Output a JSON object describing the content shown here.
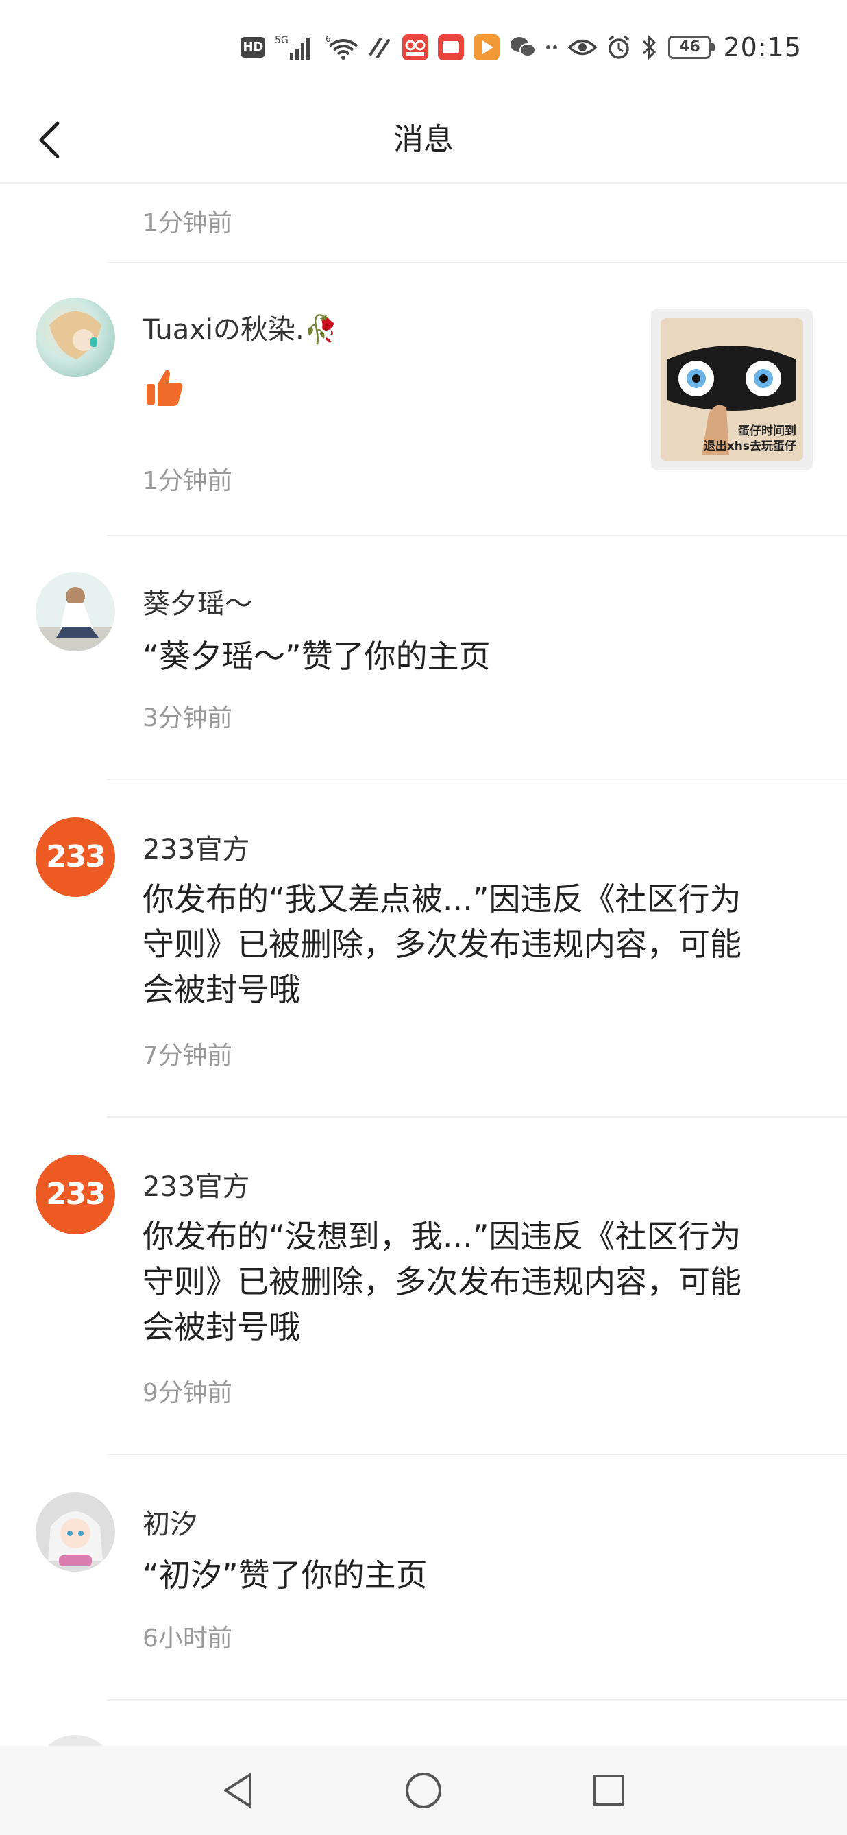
{
  "status_bar": {
    "network": "5G",
    "signal2": "6",
    "battery": "46",
    "time": "20:15",
    "hd": "HD"
  },
  "header": {
    "title": "消息"
  },
  "messages": [
    {
      "time": "1分钟前"
    },
    {
      "name": "Tuaxiの秋染.🥀",
      "body": "👍",
      "time": "1分钟前",
      "thumb_caption": "蛋仔时间到\n退出xhs去玩蛋仔"
    },
    {
      "name": "葵夕瑶～",
      "body": "“葵夕瑶～”赞了你的主页",
      "time": "3分钟前"
    },
    {
      "name": "233官方",
      "avatar_text": "233",
      "body": "你发布的“我又差点被...”因违反《社区行为守则》已被删除，多次发布违规内容，可能会被封号哦",
      "time": "7分钟前"
    },
    {
      "name": "233官方",
      "avatar_text": "233",
      "body": "你发布的“没想到，我...”因违反《社区行为守则》已被删除，多次发布违规内容，可能会被封号哦",
      "time": "9分钟前"
    },
    {
      "name": "初汐",
      "body": "“初汐”赞了你的主页",
      "time": "6小时前"
    }
  ],
  "colors": {
    "brand_orange": "#ee5a24",
    "like_orange": "#f06a2a",
    "time_gray": "#999999",
    "divider": "#eeeeee"
  }
}
